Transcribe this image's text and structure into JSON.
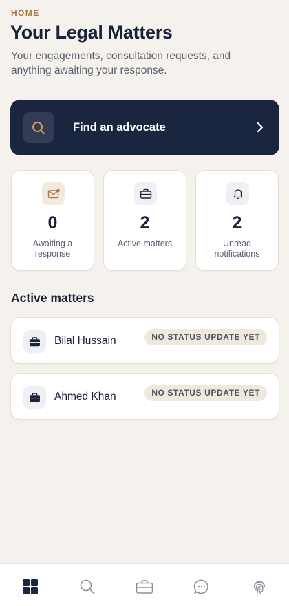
{
  "header": {
    "eyebrow": "HOME",
    "title": "Your Legal Matters",
    "subtitle": "Your engagements, consultation requests, and anything awaiting your response."
  },
  "search_banner": {
    "label": "Find an advocate",
    "icon": "search-icon"
  },
  "stats": [
    {
      "value": "0",
      "label": "Awaiting a response",
      "icon": "mail-icon"
    },
    {
      "value": "2",
      "label": "Active matters",
      "icon": "briefcase-icon"
    },
    {
      "value": "2",
      "label": "Unread notifications",
      "icon": "bell-icon"
    }
  ],
  "active_matters": {
    "heading": "Active matters",
    "items": [
      {
        "name": "Bilal Hussain",
        "status": "NO STATUS UPDATE YET",
        "icon": "briefcase-icon"
      },
      {
        "name": "Ahmed Khan",
        "status": "NO STATUS UPDATE YET",
        "icon": "briefcase-icon"
      }
    ]
  },
  "bottom_nav": [
    {
      "icon": "grid-icon",
      "active": true
    },
    {
      "icon": "search-icon",
      "active": false
    },
    {
      "icon": "briefcase-icon",
      "active": false
    },
    {
      "icon": "chat-icon",
      "active": false
    },
    {
      "icon": "fingerprint-icon",
      "active": false
    }
  ],
  "colors": {
    "background": "#f5f2ed",
    "navy": "#1a2540",
    "accent_gold": "#a8793c",
    "badge_bg": "#efe9dd"
  }
}
